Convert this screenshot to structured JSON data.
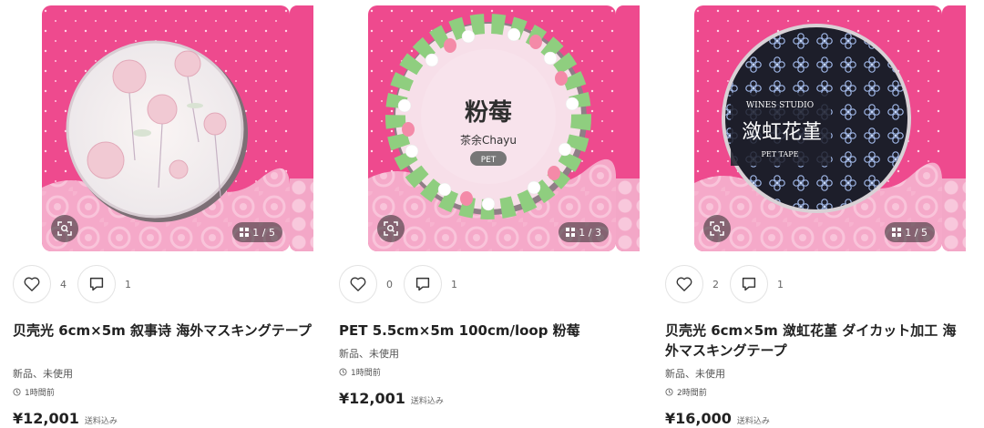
{
  "products": [
    {
      "title": "贝壳光 6cm×5m 叙事诗 海外マスキングテープ",
      "likes": "4",
      "comments": "1",
      "condition": "新品、未使用",
      "time": "1時間前",
      "price": "¥12,001",
      "tax_note": "送料込み",
      "image_page": "1 / 5"
    },
    {
      "title": "PET 5.5cm×5m 100cm/loop 粉莓",
      "likes": "0",
      "comments": "1",
      "condition": "新品、未使用",
      "time": "1時間前",
      "price": "¥12,001",
      "tax_note": "送料込み",
      "image_page": "1 / 3",
      "tape_label_main": "粉莓",
      "tape_label_sub": "茶余Chayu",
      "tape_label_tag": "PET"
    },
    {
      "title": "贝壳光 6cm×5m 潋虹花堇 ダイカット加工 海外マスキングテープ",
      "likes": "2",
      "comments": "1",
      "condition": "新品、未使用",
      "time": "2時間前",
      "price": "¥16,000",
      "tax_note": "送料込み",
      "image_page": "1 / 5",
      "tape_label_main": "潋虹花堇",
      "tape_label_brand": "WINES STUDIO",
      "tape_label_sub": "PET TAPE"
    }
  ],
  "colors": {
    "pink_background": "#ee4a8e",
    "lace": "#f6b6d0",
    "tape_dark": "#1d1e2a",
    "strawberry_tape": "#f7dfe9"
  }
}
